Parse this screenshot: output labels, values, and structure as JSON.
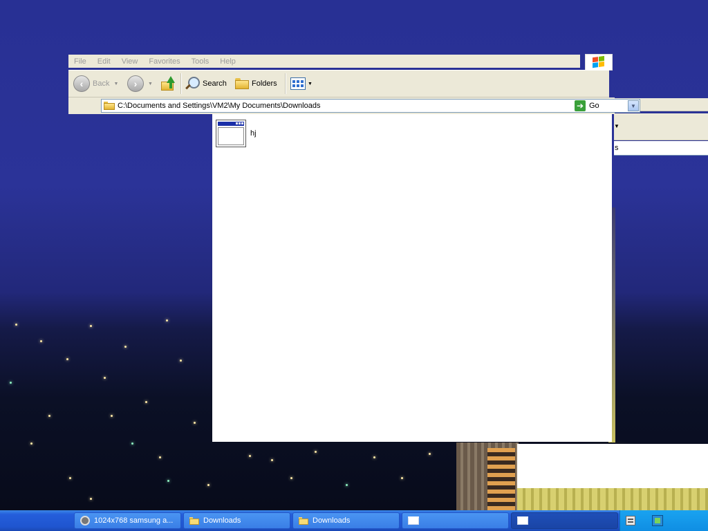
{
  "menu": [
    "File",
    "Edit",
    "View",
    "Favorites",
    "Tools",
    "Help"
  ],
  "toolbar": {
    "back_label": "Back",
    "search_label": "Search",
    "folders_label": "Folders"
  },
  "address": {
    "path": "C:\\Documents and Settings\\VM2\\My Documents\\Downloads",
    "go_label": "Go"
  },
  "files": [
    {
      "name": "hj",
      "icon": "application-window-icon"
    }
  ],
  "background_window": {
    "address_fragment": "s"
  },
  "taskbar": {
    "buttons": [
      {
        "label": "1024x768 samsung a...",
        "icon": "raccoon-icon",
        "active": false
      },
      {
        "label": "Downloads",
        "icon": "folder-icon",
        "active": false
      },
      {
        "label": "Downloads",
        "icon": "folder-icon",
        "active": false
      },
      {
        "label": "",
        "icon": "window-icon",
        "active": false
      },
      {
        "label": "",
        "icon": "window-icon",
        "active": true
      }
    ]
  },
  "colors": {
    "menubar_bg": "#ece9d8",
    "taskbar_blue": "#245edb",
    "tray_blue": "#0f8ee3"
  }
}
